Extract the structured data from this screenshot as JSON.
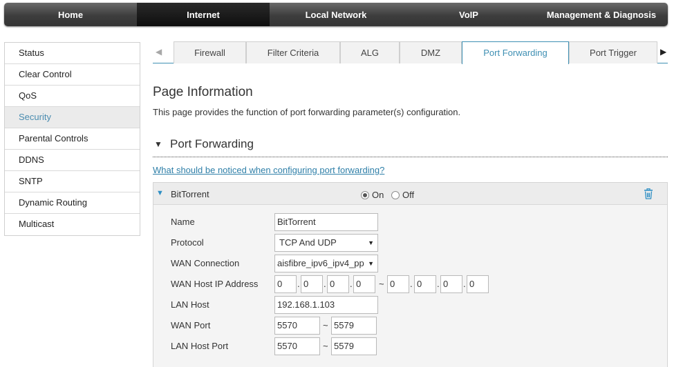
{
  "topnav": {
    "items": [
      {
        "label": "Home"
      },
      {
        "label": "Internet"
      },
      {
        "label": "Local Network"
      },
      {
        "label": "VoIP"
      },
      {
        "label": "Management & Diagnosis"
      }
    ],
    "active_index": 1
  },
  "sidebar": {
    "items": [
      {
        "label": "Status"
      },
      {
        "label": "Clear Control"
      },
      {
        "label": "QoS"
      },
      {
        "label": "Security"
      },
      {
        "label": "Parental Controls"
      },
      {
        "label": "DDNS"
      },
      {
        "label": "SNTP"
      },
      {
        "label": "Dynamic Routing"
      },
      {
        "label": "Multicast"
      }
    ],
    "active": "Security"
  },
  "tabs": {
    "prev_icon": "triangle-left-icon",
    "next_icon": "triangle-right-icon",
    "items": [
      {
        "label": "Firewall"
      },
      {
        "label": "Filter Criteria"
      },
      {
        "label": "ALG"
      },
      {
        "label": "DMZ"
      },
      {
        "label": "Port Forwarding"
      },
      {
        "label": "Port Trigger"
      }
    ],
    "active": "Port Forwarding"
  },
  "page": {
    "title": "Page Information",
    "description": "This page provides the function of port forwarding parameter(s) configuration."
  },
  "section": {
    "title": "Port Forwarding",
    "notice_link": "What should be noticed when configuring port forwarding?"
  },
  "rule": {
    "name": "BitTorrent",
    "state": {
      "on_label": "On",
      "off_label": "Off",
      "selected": "On"
    },
    "accent_color": "#2e8fc4",
    "fields": {
      "name": {
        "label": "Name",
        "value": "BitTorrent"
      },
      "protocol": {
        "label": "Protocol",
        "value": "TCP And UDP"
      },
      "wan_connection": {
        "label": "WAN Connection",
        "value": "aisfibre_ipv6_ipv4_pp"
      },
      "wan_host_ip": {
        "label": "WAN Host IP Address",
        "start": [
          "0",
          "0",
          "0",
          "0"
        ],
        "end": [
          "0",
          "0",
          "0",
          "0"
        ],
        "range_sep": "~",
        "octet_sep": "."
      },
      "lan_host": {
        "label": "LAN Host",
        "value": "192.168.1.103"
      },
      "wan_port": {
        "label": "WAN Port",
        "start": "5570",
        "end": "5579",
        "range_sep": "~"
      },
      "lan_host_port": {
        "label": "LAN Host Port",
        "start": "5570",
        "end": "5579",
        "range_sep": "~"
      }
    }
  }
}
